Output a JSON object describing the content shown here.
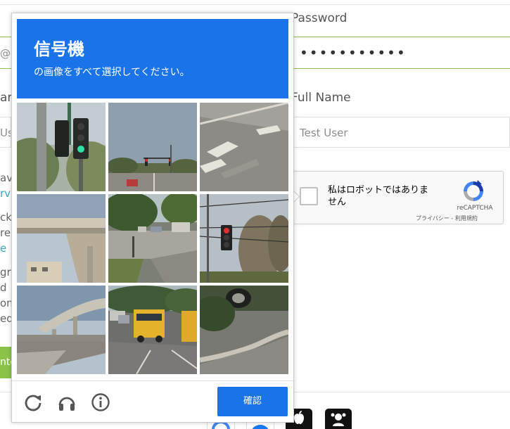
{
  "signup_form": {
    "email_fragment": "@e",
    "password_label": "Password",
    "password_value": "•••••••••••",
    "full_name_label": "Full Name",
    "full_name_placeholder": "Test User",
    "left_name_fragment": "ar",
    "left_input_fragment": "Us",
    "text_fragments": [
      "av",
      "rv",
      "ck",
      "re",
      "e",
      "gre",
      "d",
      "om",
      "edi"
    ],
    "signup_button_fragment": "nte"
  },
  "recaptcha_anchor": {
    "checkbox_label": "私はロボットではありません",
    "brand": "reCAPTCHA",
    "privacy_link": "プライバシー",
    "terms_separator": " - ",
    "terms_link": "利用規約",
    "checked": false
  },
  "challenge": {
    "title": "信号機",
    "instruction": "の画像をすべて選択してください。",
    "verify_label": "確認",
    "tiles": [
      {
        "description": "traffic-light-closeup"
      },
      {
        "description": "road-with-traffic-lights"
      },
      {
        "description": "road-markings"
      },
      {
        "description": "overpass"
      },
      {
        "description": "parking-lot-street"
      },
      {
        "description": "traffic-light-wires"
      },
      {
        "description": "highway-bridge"
      },
      {
        "description": "school-bus-traffic"
      },
      {
        "description": "curb-and-tire"
      }
    ],
    "icons": [
      "reload-icon",
      "audio-icon",
      "info-icon"
    ]
  },
  "social_logins": [
    "google-icon",
    "facebook-icon",
    "apple-icon",
    "sso-icon"
  ],
  "colors": {
    "header_blue": "#1a73e8",
    "accent_green": "#8bc34a",
    "link_blue": "#35a7c9"
  }
}
